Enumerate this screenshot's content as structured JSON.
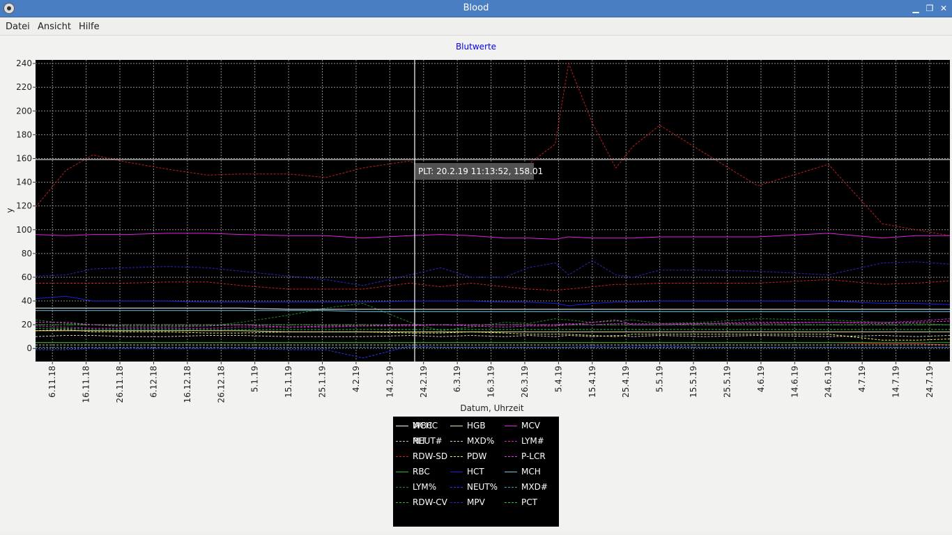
{
  "window": {
    "title": "Blood",
    "minimize_glyph": "▁",
    "maximize_glyph": "❐",
    "close_glyph": "✕"
  },
  "menu": {
    "file": "Datei",
    "view": "Ansicht",
    "help": "Hilfe"
  },
  "tooltip": {
    "text": "PLT: 20.2.19 11:13:52, 158.01"
  },
  "colors": {
    "plot_background": "#000000",
    "grid": "#8c8c8c",
    "title": "#0000ee",
    "crosshair": "#ffffff"
  },
  "chart_data": {
    "type": "line",
    "title": "Blutwerte",
    "xlabel": "Datum, Uhrzeit",
    "ylabel": "y",
    "ylim": [
      -11,
      243
    ],
    "xlim": [
      "1.11.18",
      "30.7.19"
    ],
    "grid": true,
    "legend_position": "bottom-center",
    "yticks": [
      0,
      20,
      40,
      60,
      80,
      100,
      120,
      140,
      160,
      180,
      200,
      220,
      240
    ],
    "xticks": [
      "6.11.18",
      "16.11.18",
      "26.11.18",
      "6.12.18",
      "16.12.18",
      "26.12.18",
      "5.1.19",
      "15.1.19",
      "25.1.19",
      "4.2.19",
      "14.2.19",
      "24.2.19",
      "6.3.19",
      "16.3.19",
      "26.3.19",
      "5.4.19",
      "15.4.19",
      "25.4.19",
      "5.5.19",
      "15.5.19",
      "25.5.19",
      "4.6.19",
      "14.6.19",
      "24.6.19",
      "4.7.19",
      "14.7.19",
      "24.7.19"
    ],
    "dates": [
      "1.11.18",
      "10.11.18",
      "18.11.18",
      "28.11.18",
      "10.12.18",
      "22.12.18",
      "1.1.19",
      "15.1.19",
      "26.1.19",
      "6.2.19",
      "20.2.19",
      "1.3.19",
      "10.3.19",
      "20.3.19",
      "27.3.19",
      "4.4.19",
      "8.4.19",
      "15.4.19",
      "22.4.19",
      "27.4.19",
      "5.5.19",
      "18.5.19",
      "3.6.19",
      "24.6.19",
      "10.7.19",
      "20.7.19",
      "30.7.19"
    ],
    "series": [
      {
        "name": "WBC",
        "color": "#e02020",
        "dash": "solid",
        "values": [
          5,
          5,
          5,
          5,
          5,
          5,
          5,
          5,
          5,
          5,
          5,
          5,
          5,
          5,
          5,
          5,
          5,
          5,
          5,
          5,
          5,
          5,
          5,
          5,
          4,
          4,
          3
        ]
      },
      {
        "name": "PLT",
        "color": "#c0201c",
        "dash": "dash",
        "values": [
          119,
          150,
          163,
          157,
          151,
          146,
          147,
          147,
          144,
          152,
          158,
          142,
          152,
          150,
          155,
          172,
          240,
          190,
          152,
          170,
          188,
          165,
          137,
          155,
          105,
          100,
          95
        ]
      },
      {
        "name": "RDW-SD",
        "color": "#d02020",
        "dash": "dash",
        "values": [
          55,
          55,
          55,
          55,
          56,
          56,
          53,
          50,
          50,
          50,
          55,
          52,
          55,
          52,
          50,
          49,
          50,
          52,
          54,
          54,
          55,
          55,
          55,
          58,
          54,
          55,
          57
        ]
      },
      {
        "name": "RBC",
        "color": "#20c020",
        "dash": "solid",
        "values": [
          5,
          5,
          5,
          5,
          5,
          5,
          5,
          5,
          5,
          5,
          5,
          5,
          5,
          5,
          5,
          5,
          5,
          5,
          5,
          5,
          5,
          5,
          5,
          5,
          5,
          5,
          5
        ]
      },
      {
        "name": "LYM%",
        "color": "#208a20",
        "dash": "dash",
        "values": [
          24,
          21,
          20,
          18,
          18,
          19,
          22,
          28,
          34,
          38,
          22,
          15,
          18,
          22,
          21,
          25,
          24,
          22,
          23,
          24,
          21,
          22,
          25,
          24,
          22,
          21,
          20
        ]
      },
      {
        "name": "RDW-CV",
        "color": "#30b030",
        "dash": "dash",
        "values": [
          20,
          20,
          20,
          20,
          20,
          20,
          20,
          20,
          20,
          20,
          20,
          20,
          20,
          20,
          20,
          20,
          20,
          20,
          20,
          20,
          20,
          20,
          20,
          20,
          20,
          20,
          20
        ]
      },
      {
        "name": "HGB",
        "color": "#e8e8a0",
        "dash": "solid",
        "values": [
          15,
          15,
          15,
          15,
          15,
          15,
          15,
          14,
          14,
          14,
          14,
          14,
          14,
          14,
          14,
          14,
          14,
          14,
          14,
          14,
          14,
          14,
          14,
          14,
          14,
          14,
          14
        ]
      },
      {
        "name": "MXD%",
        "color": "#d0d0d0",
        "dash": "dash",
        "values": [
          10,
          11,
          11,
          10,
          10,
          11,
          11,
          10,
          10,
          10,
          11,
          10,
          11,
          10,
          11,
          10,
          11,
          10,
          11,
          10,
          11,
          10,
          11,
          10,
          11,
          10,
          11
        ]
      },
      {
        "name": "PDW",
        "color": "#f0f070",
        "dash": "dash",
        "values": [
          15,
          16,
          14,
          14,
          14,
          13,
          13,
          14,
          14,
          14,
          13,
          13,
          14,
          13,
          12,
          12,
          12,
          11,
          10,
          12,
          12,
          12,
          12,
          12,
          7,
          7,
          8
        ]
      },
      {
        "name": "HCT",
        "color": "#2020e0",
        "dash": "solid",
        "values": [
          42,
          44,
          40,
          40,
          40,
          39,
          39,
          39,
          39,
          39,
          40,
          40,
          40,
          39,
          39,
          38,
          36,
          38,
          39,
          39,
          40,
          40,
          40,
          40,
          38,
          38,
          37
        ]
      },
      {
        "name": "NEUT%",
        "color": "#3030ff",
        "dash": "dash",
        "values": [
          -1,
          -1,
          0,
          0,
          0,
          0,
          0,
          -1,
          -1,
          -8,
          2,
          1,
          1,
          1,
          1,
          1,
          1,
          2,
          1,
          2,
          2,
          1,
          1,
          1,
          1,
          1,
          1
        ]
      },
      {
        "name": "MPV",
        "color": "#2828c8",
        "dash": "dash",
        "values": [
          61,
          62,
          67,
          68,
          69,
          68,
          65,
          61,
          58,
          53,
          62,
          68,
          60,
          60,
          68,
          72,
          62,
          74,
          62,
          60,
          66,
          66,
          65,
          62,
          72,
          73,
          71
        ]
      },
      {
        "name": "MCV",
        "color": "#e020e0",
        "dash": "solid",
        "values": [
          96,
          95,
          96,
          96,
          97,
          97,
          96,
          95,
          95,
          93,
          95,
          96,
          95,
          93,
          93,
          92,
          94,
          93,
          93,
          93,
          94,
          94,
          94,
          97,
          93,
          95,
          95
        ]
      },
      {
        "name": "LYM#",
        "color": "#d020d0",
        "dash": "dash",
        "values": [
          19,
          18,
          17,
          17,
          17,
          17,
          18,
          18,
          18,
          19,
          19,
          20,
          20,
          20,
          20,
          20,
          21,
          20,
          21,
          21,
          21,
          21,
          21,
          22,
          22,
          23,
          25
        ]
      },
      {
        "name": "P-LCR",
        "color": "#e040e0",
        "dash": "dash",
        "values": [
          22,
          22,
          20,
          19,
          19,
          19,
          20,
          18,
          19,
          19,
          20,
          20,
          19,
          18,
          19,
          19,
          20,
          22,
          24,
          20,
          20,
          21,
          22,
          22,
          21,
          22,
          23
        ]
      },
      {
        "name": "MCH",
        "color": "#60c8e8",
        "dash": "solid",
        "values": [
          32,
          32,
          32,
          32,
          32,
          32,
          32,
          32,
          32,
          31,
          31,
          31,
          31,
          31,
          31,
          31,
          31,
          31,
          31,
          31,
          31,
          31,
          31,
          31,
          31,
          31,
          31
        ]
      },
      {
        "name": "MXD#",
        "color": "#40a0c0",
        "dash": "dash",
        "values": [
          1,
          1,
          1,
          1,
          1,
          1,
          1,
          1,
          1,
          1,
          1,
          1,
          1,
          1,
          1,
          1,
          1,
          1,
          1,
          1,
          1,
          1,
          1,
          1,
          1,
          1,
          1
        ]
      },
      {
        "name": "PCT",
        "color": "#30c050",
        "dash": "dash",
        "values": [
          17,
          17,
          16,
          16,
          16,
          16,
          16,
          16,
          16,
          16,
          16,
          16,
          16,
          16,
          16,
          16,
          16,
          16,
          16,
          16,
          16,
          16,
          16,
          16,
          16,
          16,
          16
        ]
      },
      {
        "name": "MCHC",
        "color": "#ffffff",
        "dash": "solid",
        "values": [
          34,
          34,
          34,
          34,
          34,
          34,
          34,
          33,
          33,
          33,
          33,
          33,
          33,
          33,
          33,
          33,
          33,
          33,
          33,
          33,
          33,
          33,
          33,
          33,
          33,
          33,
          33
        ]
      },
      {
        "name": "NEUT#",
        "color": "#c0c0c0",
        "dash": "dash",
        "values": [
          3,
          3,
          3,
          3,
          3,
          3,
          3,
          3,
          3,
          3,
          3,
          3,
          3,
          3,
          3,
          3,
          3,
          3,
          3,
          3,
          3,
          3,
          3,
          3,
          3,
          3,
          3
        ]
      }
    ]
  }
}
